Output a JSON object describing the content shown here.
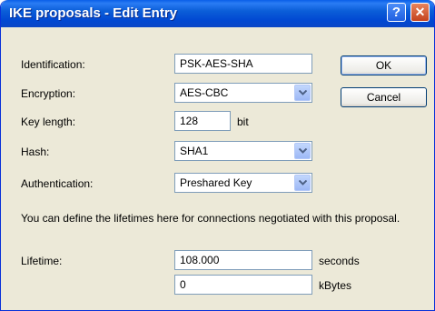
{
  "window": {
    "title": "IKE proposals - Edit Entry",
    "help_glyph": "?",
    "close_glyph": "✕"
  },
  "form": {
    "identification": {
      "label": "Identification:",
      "value": "PSK-AES-SHA"
    },
    "encryption": {
      "label": "Encryption:",
      "value": "AES-CBC"
    },
    "key_length": {
      "label": "Key length:",
      "value": "128",
      "unit": "bit"
    },
    "hash": {
      "label": "Hash:",
      "value": "SHA1"
    },
    "authentication": {
      "label": "Authentication:",
      "value": "Preshared Key"
    },
    "info_text": "You can define the lifetimes here for connections negotiated with this proposal.",
    "lifetime": {
      "label": "Lifetime:",
      "value": "108.000",
      "unit": "seconds"
    },
    "lifetime_kbytes": {
      "value": "0",
      "unit": "kBytes"
    }
  },
  "buttons": {
    "ok": "OK",
    "cancel": "Cancel"
  },
  "icons": {
    "dropdown": "chevron-down-icon"
  }
}
